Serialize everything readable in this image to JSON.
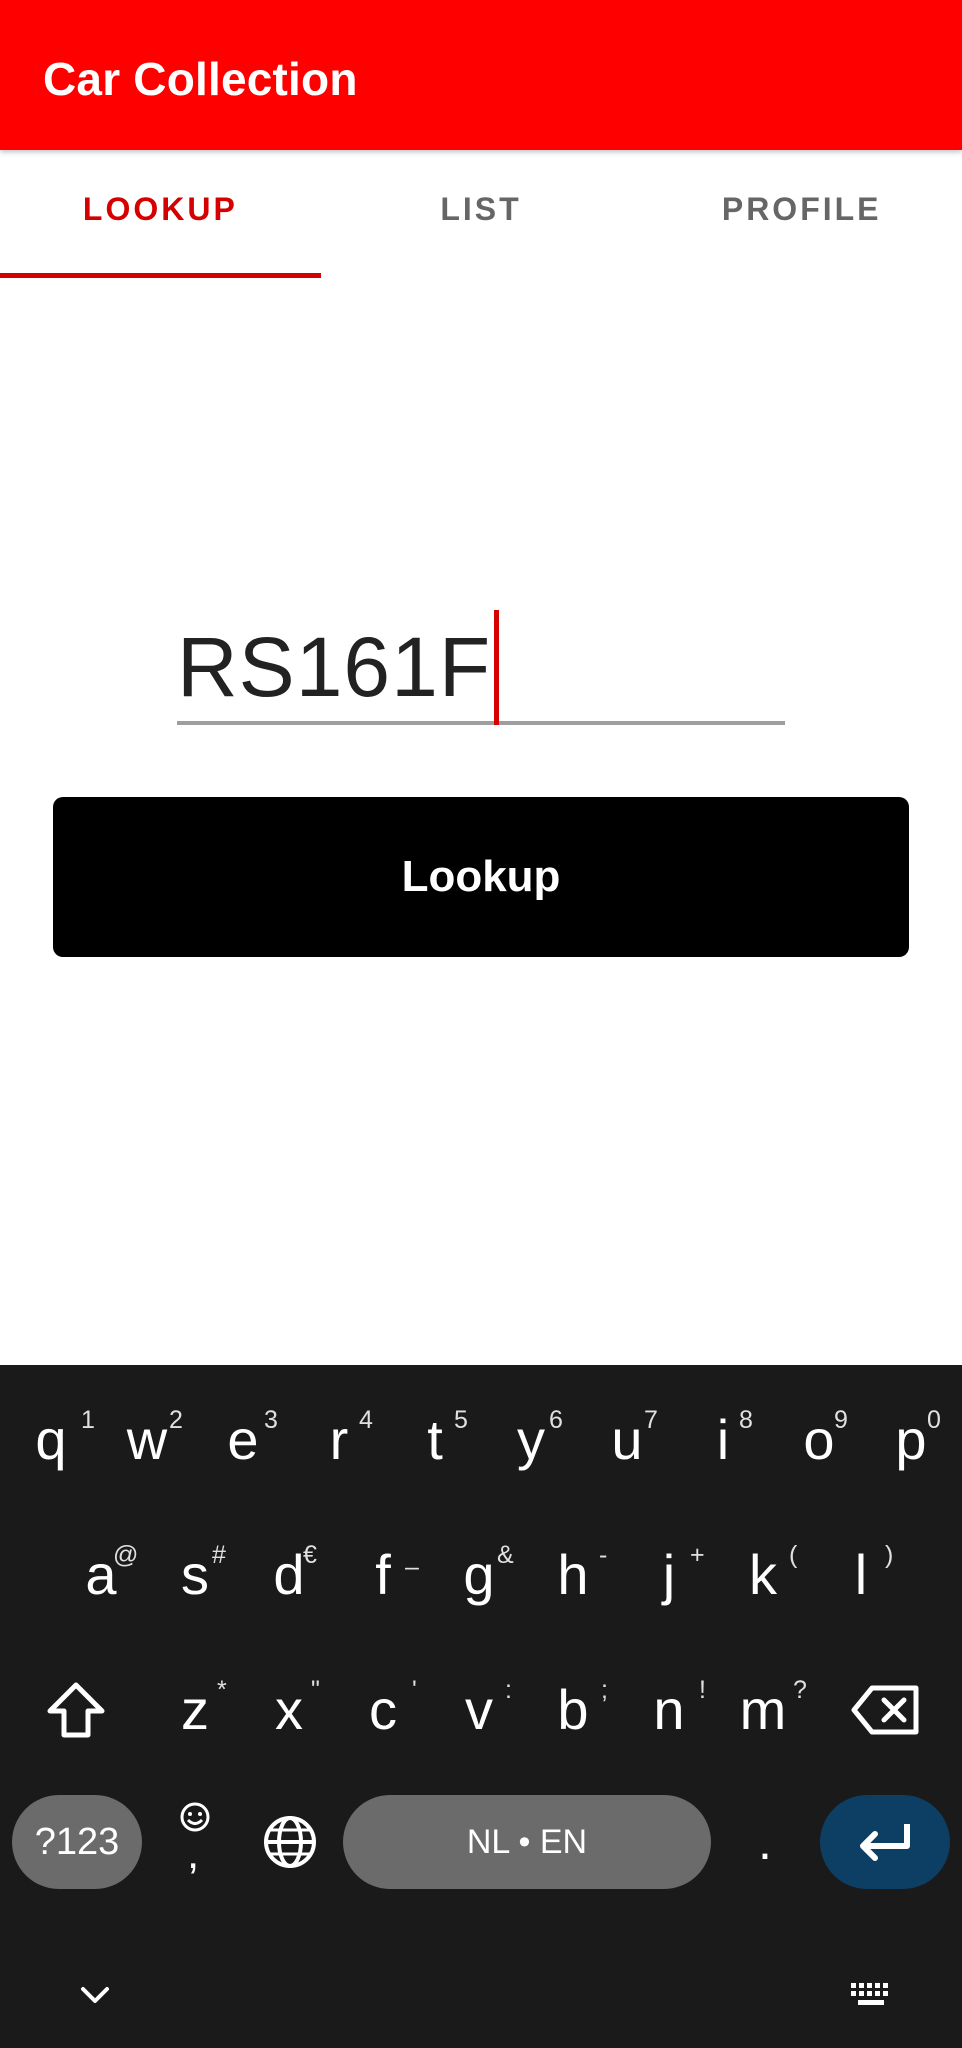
{
  "app": {
    "title": "Car Collection",
    "accent_color": "#ff0000",
    "tab_active_color": "#d50000"
  },
  "tabs": [
    {
      "label": "LOOKUP",
      "active": true
    },
    {
      "label": "LIST",
      "active": false
    },
    {
      "label": "PROFILE",
      "active": false
    }
  ],
  "lookup": {
    "plate_value": "RS161F",
    "button_label": "Lookup"
  },
  "keyboard": {
    "row1": [
      {
        "ch": "q",
        "hint": "1"
      },
      {
        "ch": "w",
        "hint": "2"
      },
      {
        "ch": "e",
        "hint": "3"
      },
      {
        "ch": "r",
        "hint": "4"
      },
      {
        "ch": "t",
        "hint": "5"
      },
      {
        "ch": "y",
        "hint": "6"
      },
      {
        "ch": "u",
        "hint": "7"
      },
      {
        "ch": "i",
        "hint": "8"
      },
      {
        "ch": "o",
        "hint": "9"
      },
      {
        "ch": "p",
        "hint": "0"
      }
    ],
    "row2": [
      {
        "ch": "a",
        "hint": "@"
      },
      {
        "ch": "s",
        "hint": "#"
      },
      {
        "ch": "d",
        "hint": "€"
      },
      {
        "ch": "f",
        "hint": "–"
      },
      {
        "ch": "g",
        "hint": "&"
      },
      {
        "ch": "h",
        "hint": "-"
      },
      {
        "ch": "j",
        "hint": "+"
      },
      {
        "ch": "k",
        "hint": "("
      },
      {
        "ch": "l",
        "hint": ")"
      }
    ],
    "row3": [
      {
        "ch": "z",
        "hint": "*"
      },
      {
        "ch": "x",
        "hint": "\""
      },
      {
        "ch": "c",
        "hint": "'"
      },
      {
        "ch": "v",
        "hint": ":"
      },
      {
        "ch": "b",
        "hint": ";"
      },
      {
        "ch": "n",
        "hint": "!"
      },
      {
        "ch": "m",
        "hint": "?"
      }
    ],
    "symbols_label": "?123",
    "comma_label": ",",
    "space_label": "NL • EN",
    "period_label": ".",
    "icons": {
      "shift": "shift-icon",
      "backspace": "backspace-icon",
      "emoji": "emoji-icon",
      "language": "globe-icon",
      "enter": "enter-icon",
      "collapse": "chevron-down-icon",
      "switch_keyboard": "keyboard-icon"
    },
    "background": "#1a1a1a",
    "key_pill_color": "#6b6b6b",
    "enter_color": "#0d3e63"
  }
}
